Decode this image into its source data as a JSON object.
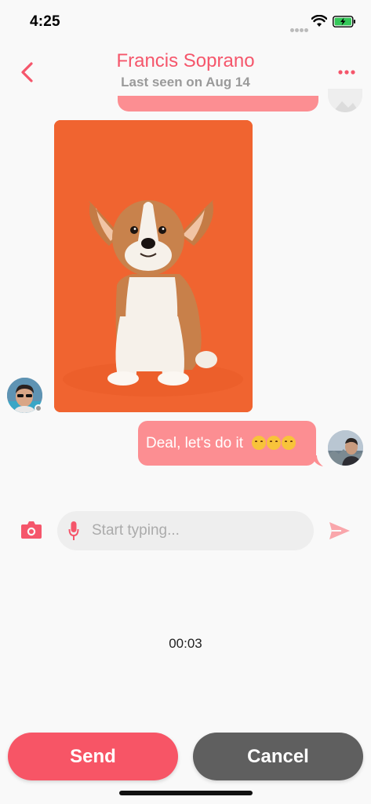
{
  "status_bar": {
    "time": "4:25"
  },
  "header": {
    "contact_name": "Francis Soprano",
    "last_seen": "Last seen on Aug 14"
  },
  "messages": {
    "sent_text": "Deal, let's do it",
    "sent_emojis": [
      "kissing-face-emoji",
      "kissing-face-emoji",
      "kissing-face-emoji"
    ]
  },
  "composer": {
    "placeholder": "Start typing...",
    "value": ""
  },
  "recording": {
    "timer": "00:03"
  },
  "actions": {
    "send_label": "Send",
    "cancel_label": "Cancel"
  },
  "colors": {
    "accent": "#f5566b",
    "bubble": "#fc8e92",
    "send_button": "#f75566",
    "cancel_button": "#5f5f5f",
    "photo_background": "#f06430"
  }
}
